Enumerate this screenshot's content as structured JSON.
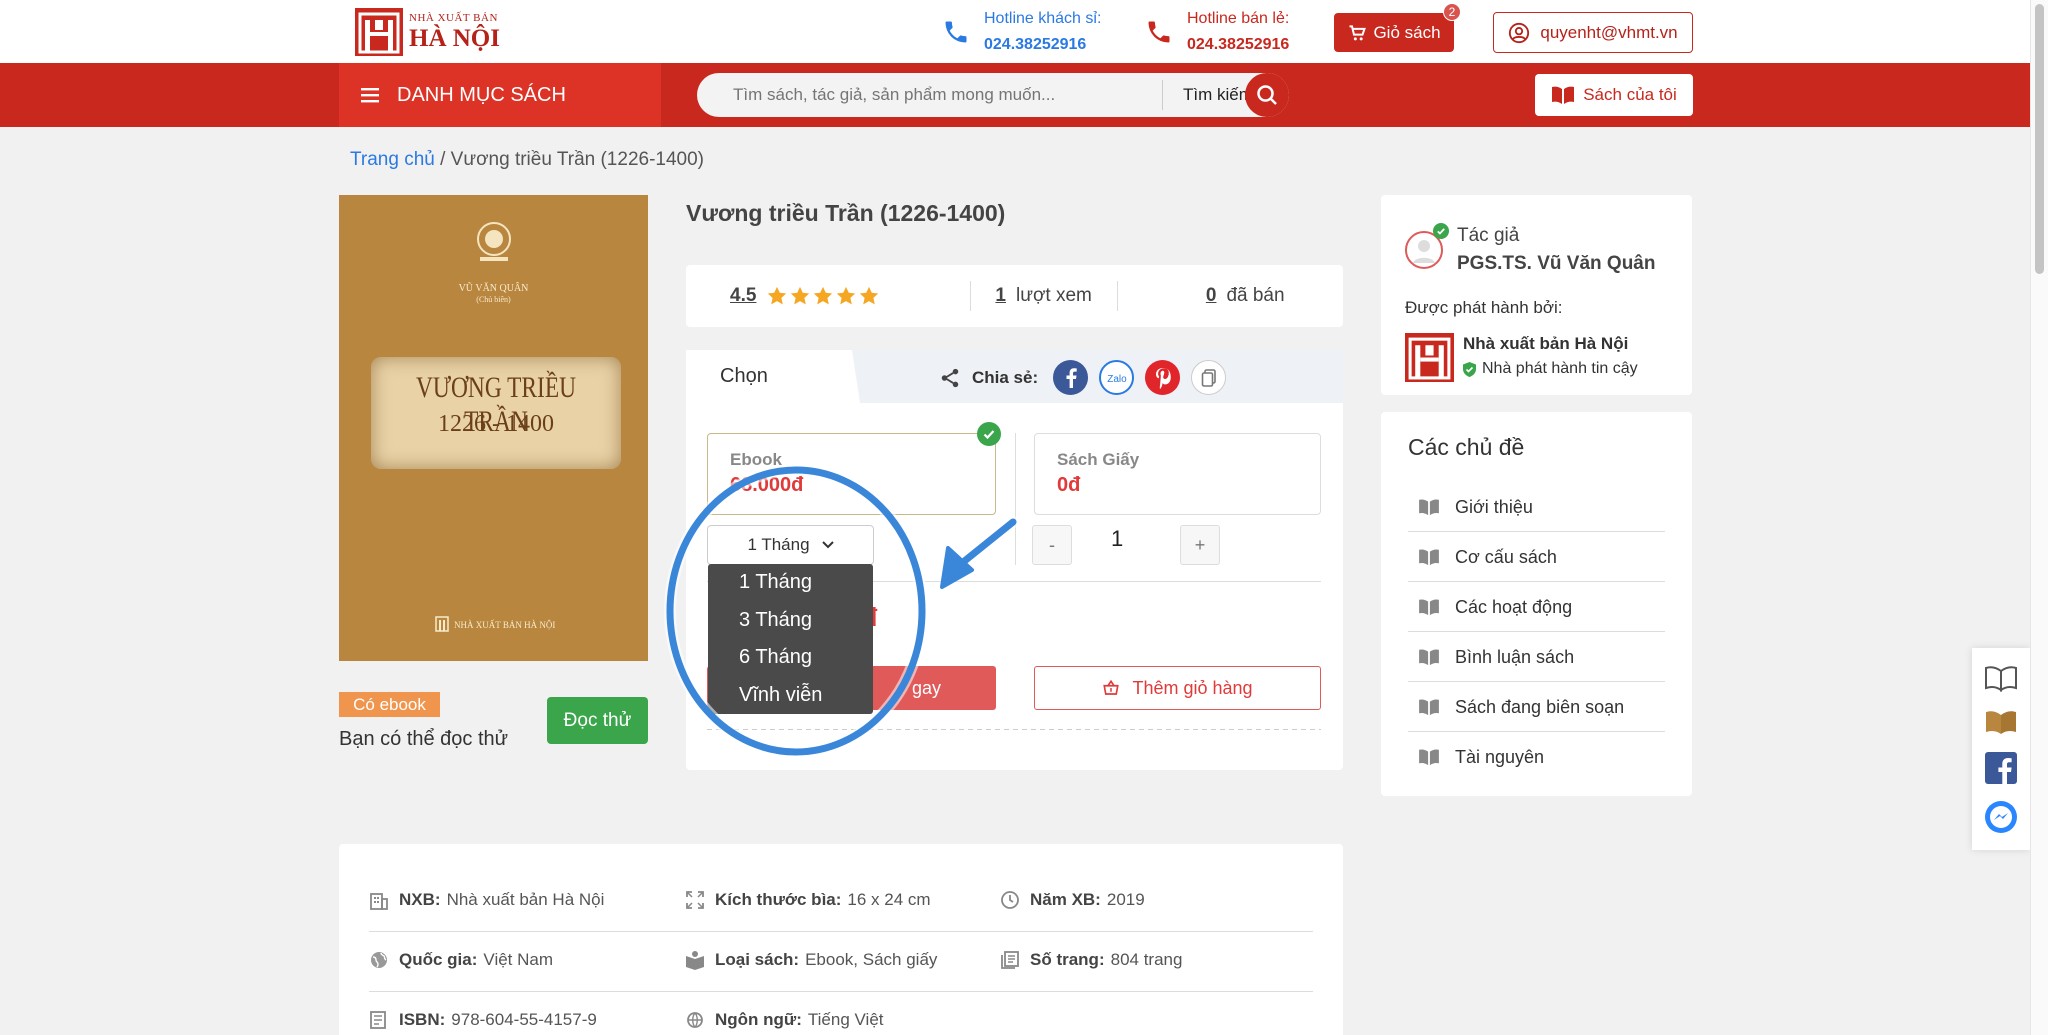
{
  "header": {
    "logo_line1": "NHÀ XUẤT BẢN",
    "logo_line2": "HÀ NỘI",
    "hotline1_label": "Hotline khách sỉ:",
    "hotline1_number": "024.38252916",
    "hotline2_label": "Hotline bán lẻ:",
    "hotline2_number": "024.38252916",
    "cart_label": "Giỏ sách",
    "cart_count": "2",
    "user_email": "quyenht@vhmt.vn"
  },
  "nav": {
    "category_label": "DANH MỤC SÁCH",
    "search_placeholder": "Tìm sách, tác giả, sản phẩm mong muốn...",
    "search_label": "Tìm kiếm",
    "my_books_label": "Sách của tôi"
  },
  "breadcrumb": {
    "home": "Trang chủ",
    "current": "/ Vương triều Trần (1226-1400)"
  },
  "cover": {
    "author": "VŨ VĂN QUÂN",
    "author_note": "(Chủ biên)",
    "title": "VƯƠNG TRIỀU TRẦN",
    "years": "1226 - 1400",
    "publisher": "NHÀ XUẤT BẢN HÀ NỘI"
  },
  "book": {
    "title": "Vương triều Trần (1226-1400)",
    "rating": "4.5",
    "rating_stars": 5,
    "views": "1",
    "views_label": "lượt xem",
    "sold": "0",
    "sold_label": "đã bán",
    "ebook_badge": "Có ebook",
    "try_text": "Bạn có thể đọc thử",
    "try_button": "Đọc thử"
  },
  "purchase": {
    "tab_label": "Chọn",
    "share_label": "Chia sẻ:",
    "ebook_label": "Ebook",
    "ebook_price": "68.000đ",
    "paper_label": "Sách Giấy",
    "paper_price": "0đ",
    "duration_selected": "1 Tháng",
    "duration_options": [
      "1 Tháng",
      "3 Tháng",
      "6 Tháng",
      "Vĩnh viễn"
    ],
    "qty_minus": "-",
    "quantity": "1",
    "qty_plus": "+",
    "total_partial": "0đ",
    "buy_now_partial": "gay",
    "add_to_cart": "Thêm giỏ hàng"
  },
  "author_card": {
    "label": "Tác giả",
    "name": "PGS.TS. Vũ Văn Quân",
    "published_by_label": "Được phát hành bởi:",
    "publisher": "Nhà xuất bản Hà Nội",
    "trusted": "Nhà phát hành tin cậy"
  },
  "topics": {
    "heading": "Các chủ đề",
    "items": [
      "Giới thiệu",
      "Cơ cấu sách",
      "Các hoạt động",
      "Bình luận sách",
      "Sách đang biên soạn",
      "Tài nguyên"
    ]
  },
  "details": {
    "nxb_label": "NXB:",
    "nxb": "Nhà xuất bản Hà Nội",
    "size_label": "Kích thước bìa:",
    "size": "16 x 24 cm",
    "year_label": "Năm XB:",
    "year": "2019",
    "country_label": "Quốc gia:",
    "country": "Việt Nam",
    "type_label": "Loại sách:",
    "type": "Ebook, Sách giấy",
    "pages_label": "Số trang:",
    "pages": "804 trang",
    "isbn_label": "ISBN:",
    "isbn": "978-604-55-4157-9",
    "lang_label": "Ngôn ngữ:",
    "lang": "Tiếng Việt"
  },
  "colors": {
    "brand": "#c8281e",
    "accent_blue": "#2a7ae2",
    "green": "#3aa54a",
    "price_red": "#e03a3a"
  }
}
